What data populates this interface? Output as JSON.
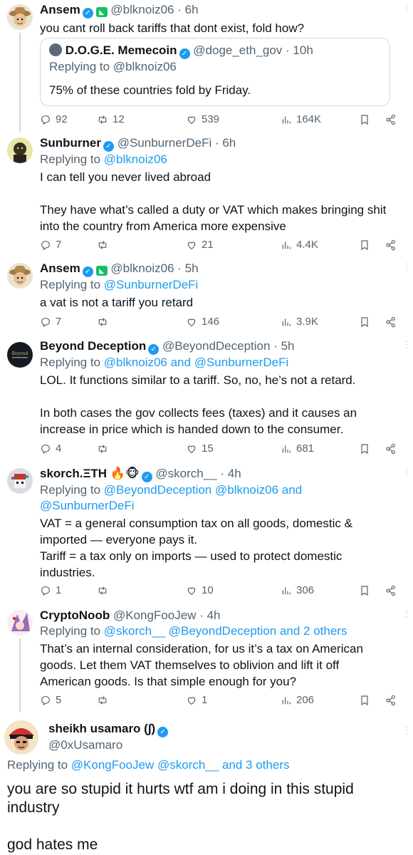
{
  "tweets": [
    {
      "name": "Ansem",
      "handle": "@blknoiz06",
      "time": "· 6h",
      "text": "you cant roll back tariffs that dont exist, fold how?",
      "quote": {
        "name": "D.O.G.E. Memecoin",
        "handle": "@doge_eth_gov",
        "time": "· 10h",
        "replying_label": "Replying to",
        "replying_to": "@blknoiz06",
        "text": "75% of these countries fold by Friday."
      },
      "stats": {
        "replies": "92",
        "retweets": "12",
        "likes": "539",
        "views": "164K"
      }
    },
    {
      "name": "Sunburner",
      "handle": "@SunburnerDeFi",
      "time": "· 6h",
      "replying_label": "Replying to",
      "replying_to": "@blknoiz06",
      "text": "I can tell you never lived abroad\n\nThey have what’s called a duty or VAT which makes bringing shit into the country from America more expensive",
      "stats": {
        "replies": "7",
        "retweets": "",
        "likes": "21",
        "views": "4.4K"
      }
    },
    {
      "name": "Ansem",
      "handle": "@blknoiz06",
      "time": "· 5h",
      "replying_label": "Replying to",
      "replying_to": "@SunburnerDeFi",
      "text": "a vat is not a tariff you retard",
      "stats": {
        "replies": "7",
        "retweets": "",
        "likes": "146",
        "views": "3.9K"
      }
    },
    {
      "name": "Beyond Deception",
      "handle": "@BeyondDeception",
      "time": "· 5h",
      "replying_label": "Replying to",
      "replying_to": "@blknoiz06 and @SunburnerDeFi",
      "text": "LOL. It functions similar to a tariff. So, no, he’s not a retard.\n\nIn both cases the gov collects fees (taxes) and it causes an increase in price which is handed down to the consumer.",
      "stats": {
        "replies": "4",
        "retweets": "",
        "likes": "15",
        "views": "681"
      }
    },
    {
      "name": "skorch.ΞTH",
      "name_emoji": "🔥🐵",
      "handle": "@skorch__",
      "time": "· 4h",
      "replying_label": "Replying to",
      "replying_to": "@BeyondDeception @blknoiz06 and @SunburnerDeFi",
      "text": "VAT = a general consumption tax on all goods, domestic & imported — everyone pays it.\nTariff = a tax only on imports — used to protect domestic industries.",
      "stats": {
        "replies": "1",
        "retweets": "",
        "likes": "10",
        "views": "306"
      }
    },
    {
      "name": "CryptoNoob",
      "handle": "@KongFooJew",
      "time": "· 4h",
      "replying_label": "Replying to",
      "replying_to": "@skorch__ @BeyondDeception and 2 others",
      "text": "That’s an internal consideration, for us it’s a tax on American goods. Let them VAT themselves to oblivion and lift it off American goods. Is that simple enough for you?",
      "stats": {
        "replies": "5",
        "retweets": "",
        "likes": "1",
        "views": "206"
      }
    }
  ],
  "main_tweet": {
    "name": "sheikh usamaro (∫)",
    "handle": "@0xUsamaro",
    "replying_label": "Replying to",
    "replying_to": "@KongFooJew @skorch__ and 3 others",
    "text": "you are so stupid it hurts wtf am i doing in this stupid industry\n\ngod hates me"
  },
  "colors": {
    "accent": "#1d9bf0",
    "muted": "#536471",
    "text": "#0f1419",
    "border": "#cfd9de"
  }
}
